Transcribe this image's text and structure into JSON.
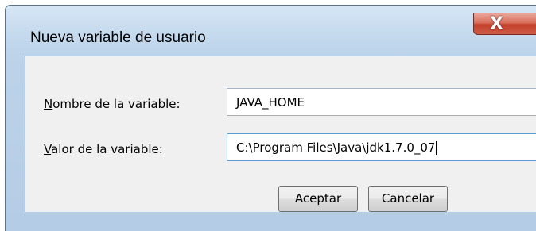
{
  "dialog": {
    "title": "Nueva variable de usuario",
    "close_glyph": "X"
  },
  "fields": {
    "name": {
      "label_mnemonic": "N",
      "label_rest": "ombre de la variable:",
      "value": "JAVA_HOME"
    },
    "value": {
      "label_mnemonic": "V",
      "label_rest": "alor de la variable:",
      "value": "C:\\Program Files\\Java\\jdk1.7.0_07"
    }
  },
  "buttons": {
    "ok": "Aceptar",
    "cancel": "Cancelar"
  },
  "icons": {
    "close": "close-icon"
  },
  "colors": {
    "title_bar": "#c8dcef",
    "close_button": "#c2402b",
    "focus_border": "#5a9cd8",
    "client_background": "#f0f0f0"
  }
}
